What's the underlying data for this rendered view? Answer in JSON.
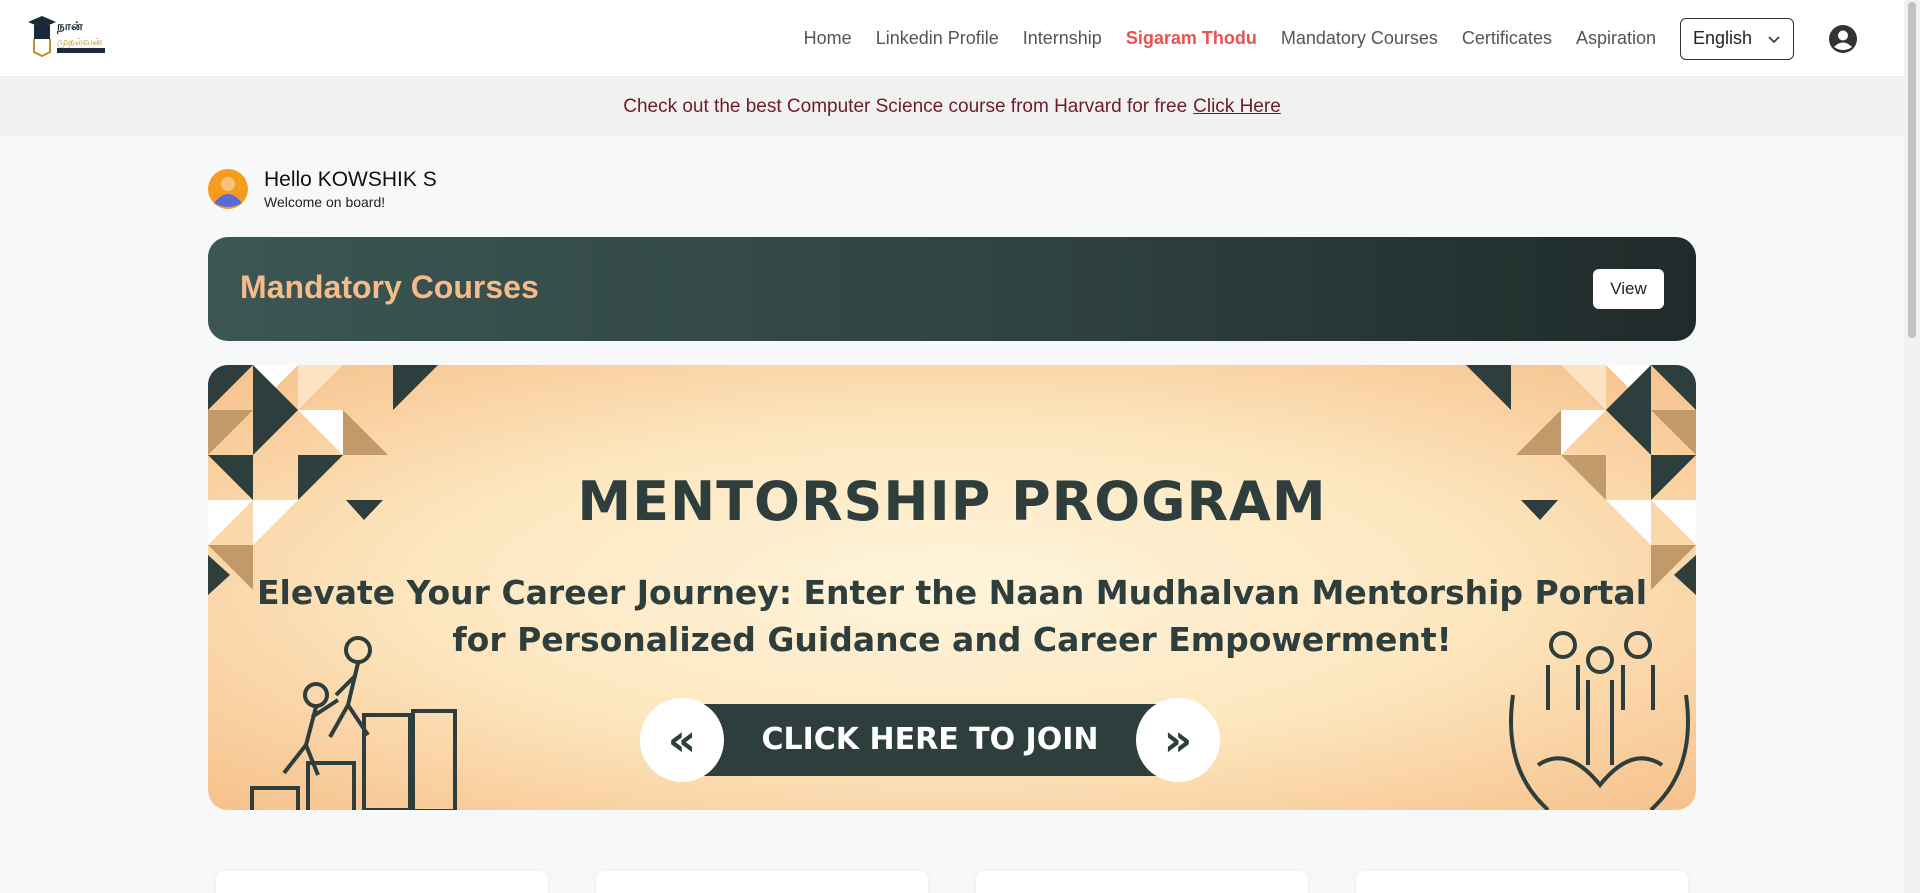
{
  "nav": {
    "items": [
      {
        "label": "Home",
        "active": false
      },
      {
        "label": "Linkedin Profile",
        "active": false
      },
      {
        "label": "Internship",
        "active": false
      },
      {
        "label": "Sigaram Thodu",
        "active": true
      },
      {
        "label": "Mandatory Courses",
        "active": false
      },
      {
        "label": "Certificates",
        "active": false
      },
      {
        "label": "Aspiration",
        "active": false
      }
    ],
    "language": "English",
    "account_icon": "account-circle-icon"
  },
  "logo": {
    "alt": "நான் முதல்வன்"
  },
  "announcement": {
    "text": "Check out the best Computer Science course from Harvard for free",
    "link": "Click Here"
  },
  "greeting": {
    "name": "Hello KOWSHIK S",
    "subtitle": "Welcome on board!"
  },
  "mandatory": {
    "title": "Mandatory Courses",
    "button": "View"
  },
  "mentorship": {
    "title": "MENTORSHIP PROGRAM",
    "line1": "Elevate Your Career Journey: Enter the Naan Mudhalvan Mentorship Portal",
    "line2": "for Personalized Guidance and Career Empowerment!",
    "cta": "CLICK HERE TO JOIN",
    "cta_left": "«",
    "cta_right": "»"
  },
  "colors": {
    "accent": "#e8524f",
    "banner_dark": "#2f4341",
    "banner_title": "#f7bb8a",
    "announce_text": "#6b1d2b",
    "mentor_text": "#2d3e3c"
  }
}
